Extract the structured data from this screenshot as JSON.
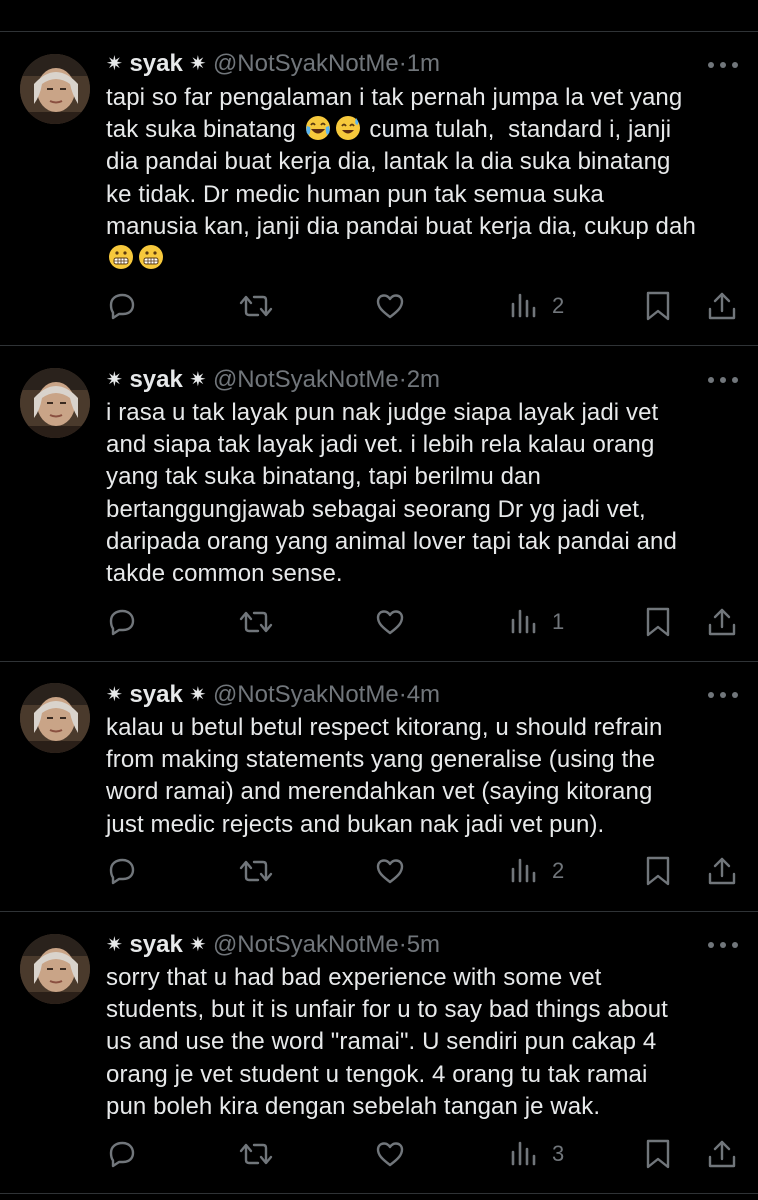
{
  "colors": {
    "background": "#000000",
    "text": "#e7e9ea",
    "muted": "#71767b",
    "divider": "#2f3336"
  },
  "tweets": [
    {
      "name": "syak",
      "star_left": "✷",
      "star_right": "✷",
      "handle": "@NotSyakNotMe",
      "dot": "·",
      "time": "1m",
      "lines": [
        "tapi so far pengalaman i tak pernah jumpa la vet yang",
        "tak suka binatang",
        "cuma tulah,  standard i, janji",
        "dia pandai buat kerja dia, lantak la dia suka binatang",
        "ke tidak. Dr medic human pun tak semua suka",
        "manusia kan, janji dia pandai buat kerja dia, cukup dah"
      ],
      "emojis": [
        "joy",
        "sweat-smile",
        "grimace",
        "grimace"
      ],
      "views": "2"
    },
    {
      "name": "syak",
      "star_left": "✷",
      "star_right": "✷",
      "handle": "@NotSyakNotMe",
      "dot": "·",
      "time": "2m",
      "text": "i rasa u tak layak pun nak judge siapa layak jadi vet\nand siapa tak layak jadi vet. i lebih rela kalau orang\nyang tak suka binatang, tapi berilmu dan\nbertanggungjawab sebagai seorang Dr yg jadi vet,\ndaripada orang yang animal lover tapi tak pandai and\ntakde common sense.",
      "views": "1"
    },
    {
      "name": "syak",
      "star_left": "✷",
      "star_right": "✷",
      "handle": "@NotSyakNotMe",
      "dot": "·",
      "time": "4m",
      "text": "kalau u betul betul respect kitorang, u should refrain\nfrom making statements yang generalise (using the\nword ramai) and merendahkan vet (saying kitorang\njust medic rejects and bukan nak jadi vet pun).",
      "views": "2"
    },
    {
      "name": "syak",
      "star_left": "✷",
      "star_right": "✷",
      "handle": "@NotSyakNotMe",
      "dot": "·",
      "time": "5m",
      "text": "sorry that u had bad experience with some vet\nstudents, but it is unfair for u to say bad things about\nus and use the word \"ramai\". U sendiri pun cakap 4\norang je vet student u tengok. 4 orang tu tak ramai\npun boleh kira dengan sebelah tangan je wak.",
      "views": "3"
    }
  ],
  "icons": {
    "reply": "reply-icon",
    "retweet": "retweet-icon",
    "like": "heart-icon",
    "views": "views-icon",
    "bookmark": "bookmark-icon",
    "share": "share-icon",
    "more": "more-icon"
  }
}
